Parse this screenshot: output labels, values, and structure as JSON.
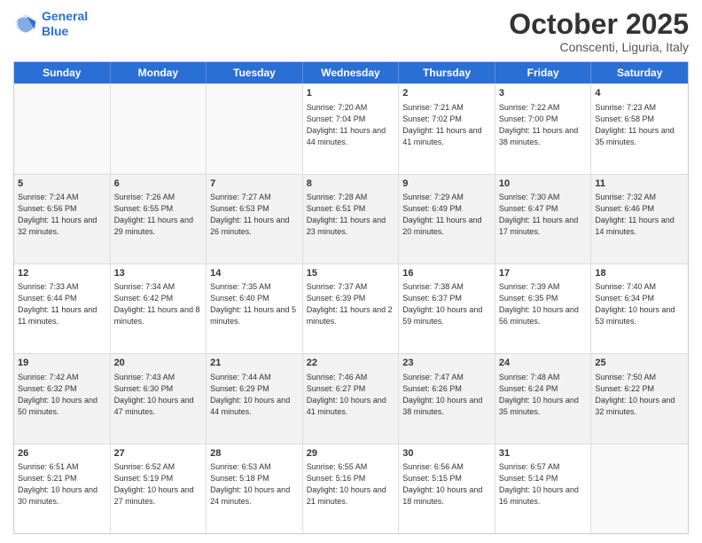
{
  "logo": {
    "line1": "General",
    "line2": "Blue"
  },
  "title": "October 2025",
  "subtitle": "Conscenti, Liguria, Italy",
  "header_days": [
    "Sunday",
    "Monday",
    "Tuesday",
    "Wednesday",
    "Thursday",
    "Friday",
    "Saturday"
  ],
  "rows": [
    [
      {
        "day": "",
        "info": ""
      },
      {
        "day": "",
        "info": ""
      },
      {
        "day": "",
        "info": ""
      },
      {
        "day": "1",
        "info": "Sunrise: 7:20 AM\nSunset: 7:04 PM\nDaylight: 11 hours\nand 44 minutes."
      },
      {
        "day": "2",
        "info": "Sunrise: 7:21 AM\nSunset: 7:02 PM\nDaylight: 11 hours\nand 41 minutes."
      },
      {
        "day": "3",
        "info": "Sunrise: 7:22 AM\nSunset: 7:00 PM\nDaylight: 11 hours\nand 38 minutes."
      },
      {
        "day": "4",
        "info": "Sunrise: 7:23 AM\nSunset: 6:58 PM\nDaylight: 11 hours\nand 35 minutes."
      }
    ],
    [
      {
        "day": "5",
        "info": "Sunrise: 7:24 AM\nSunset: 6:56 PM\nDaylight: 11 hours\nand 32 minutes."
      },
      {
        "day": "6",
        "info": "Sunrise: 7:26 AM\nSunset: 6:55 PM\nDaylight: 11 hours\nand 29 minutes."
      },
      {
        "day": "7",
        "info": "Sunrise: 7:27 AM\nSunset: 6:53 PM\nDaylight: 11 hours\nand 26 minutes."
      },
      {
        "day": "8",
        "info": "Sunrise: 7:28 AM\nSunset: 6:51 PM\nDaylight: 11 hours\nand 23 minutes."
      },
      {
        "day": "9",
        "info": "Sunrise: 7:29 AM\nSunset: 6:49 PM\nDaylight: 11 hours\nand 20 minutes."
      },
      {
        "day": "10",
        "info": "Sunrise: 7:30 AM\nSunset: 6:47 PM\nDaylight: 11 hours\nand 17 minutes."
      },
      {
        "day": "11",
        "info": "Sunrise: 7:32 AM\nSunset: 6:46 PM\nDaylight: 11 hours\nand 14 minutes."
      }
    ],
    [
      {
        "day": "12",
        "info": "Sunrise: 7:33 AM\nSunset: 6:44 PM\nDaylight: 11 hours\nand 11 minutes."
      },
      {
        "day": "13",
        "info": "Sunrise: 7:34 AM\nSunset: 6:42 PM\nDaylight: 11 hours\nand 8 minutes."
      },
      {
        "day": "14",
        "info": "Sunrise: 7:35 AM\nSunset: 6:40 PM\nDaylight: 11 hours\nand 5 minutes."
      },
      {
        "day": "15",
        "info": "Sunrise: 7:37 AM\nSunset: 6:39 PM\nDaylight: 11 hours\nand 2 minutes."
      },
      {
        "day": "16",
        "info": "Sunrise: 7:38 AM\nSunset: 6:37 PM\nDaylight: 10 hours\nand 59 minutes."
      },
      {
        "day": "17",
        "info": "Sunrise: 7:39 AM\nSunset: 6:35 PM\nDaylight: 10 hours\nand 56 minutes."
      },
      {
        "day": "18",
        "info": "Sunrise: 7:40 AM\nSunset: 6:34 PM\nDaylight: 10 hours\nand 53 minutes."
      }
    ],
    [
      {
        "day": "19",
        "info": "Sunrise: 7:42 AM\nSunset: 6:32 PM\nDaylight: 10 hours\nand 50 minutes."
      },
      {
        "day": "20",
        "info": "Sunrise: 7:43 AM\nSunset: 6:30 PM\nDaylight: 10 hours\nand 47 minutes."
      },
      {
        "day": "21",
        "info": "Sunrise: 7:44 AM\nSunset: 6:29 PM\nDaylight: 10 hours\nand 44 minutes."
      },
      {
        "day": "22",
        "info": "Sunrise: 7:46 AM\nSunset: 6:27 PM\nDaylight: 10 hours\nand 41 minutes."
      },
      {
        "day": "23",
        "info": "Sunrise: 7:47 AM\nSunset: 6:26 PM\nDaylight: 10 hours\nand 38 minutes."
      },
      {
        "day": "24",
        "info": "Sunrise: 7:48 AM\nSunset: 6:24 PM\nDaylight: 10 hours\nand 35 minutes."
      },
      {
        "day": "25",
        "info": "Sunrise: 7:50 AM\nSunset: 6:22 PM\nDaylight: 10 hours\nand 32 minutes."
      }
    ],
    [
      {
        "day": "26",
        "info": "Sunrise: 6:51 AM\nSunset: 5:21 PM\nDaylight: 10 hours\nand 30 minutes."
      },
      {
        "day": "27",
        "info": "Sunrise: 6:52 AM\nSunset: 5:19 PM\nDaylight: 10 hours\nand 27 minutes."
      },
      {
        "day": "28",
        "info": "Sunrise: 6:53 AM\nSunset: 5:18 PM\nDaylight: 10 hours\nand 24 minutes."
      },
      {
        "day": "29",
        "info": "Sunrise: 6:55 AM\nSunset: 5:16 PM\nDaylight: 10 hours\nand 21 minutes."
      },
      {
        "day": "30",
        "info": "Sunrise: 6:56 AM\nSunset: 5:15 PM\nDaylight: 10 hours\nand 18 minutes."
      },
      {
        "day": "31",
        "info": "Sunrise: 6:57 AM\nSunset: 5:14 PM\nDaylight: 10 hours\nand 16 minutes."
      },
      {
        "day": "",
        "info": ""
      }
    ]
  ]
}
